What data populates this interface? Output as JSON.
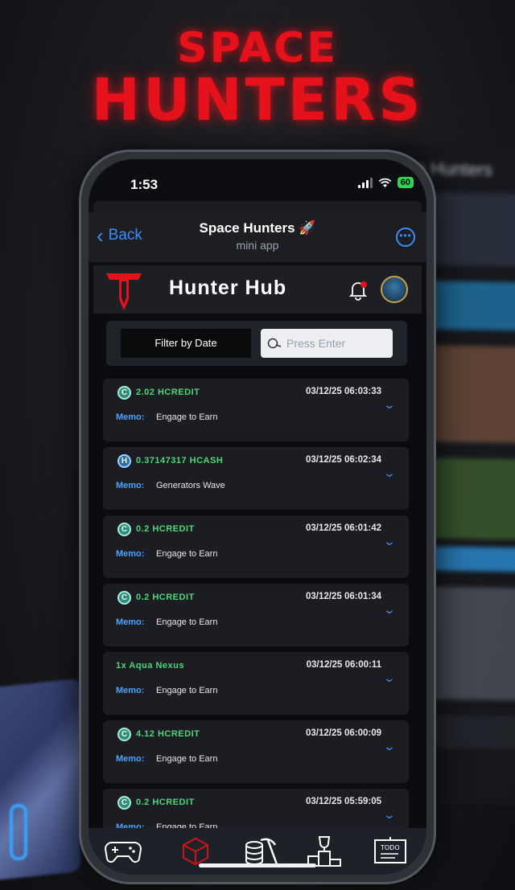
{
  "logo": {
    "line1": "SPACE",
    "line2": "HUNTERS"
  },
  "background_phone": {
    "title": "e Hunters"
  },
  "status_bar": {
    "time": "1:53",
    "battery": "60"
  },
  "nav": {
    "back_label": "Back",
    "title": "Space Hunters 🚀",
    "subtitle": "mini app"
  },
  "header": {
    "title": "Hunter Hub"
  },
  "filter": {
    "date_button": "Filter by Date",
    "search_placeholder": "Press Enter"
  },
  "memo_label": "Memo:",
  "transactions": [
    {
      "icon": "hcredit-coin-icon",
      "icon_glyph": "C",
      "amount": "2.02 HCREDIT",
      "date": "03/12/25 06:03:33",
      "memo": "Engage to Earn"
    },
    {
      "icon": "hcash-coin-icon",
      "icon_glyph": "H",
      "amount": "0.37147317 HCASH",
      "date": "03/12/25 06:02:34",
      "memo": "Generators Wave"
    },
    {
      "icon": "hcredit-coin-icon",
      "icon_glyph": "C",
      "amount": "0.2 HCREDIT",
      "date": "03/12/25 06:01:42",
      "memo": "Engage to Earn"
    },
    {
      "icon": "hcredit-coin-icon",
      "icon_glyph": "C",
      "amount": "0.2 HCREDIT",
      "date": "03/12/25 06:01:34",
      "memo": "Engage to Earn"
    },
    {
      "icon": "",
      "icon_glyph": "",
      "amount": "1x Aqua Nexus",
      "date": "03/12/25 06:00:11",
      "memo": "Engage to Earn"
    },
    {
      "icon": "hcredit-coin-icon",
      "icon_glyph": "C",
      "amount": "4.12 HCREDIT",
      "date": "03/12/25 06:00:09",
      "memo": "Engage to Earn"
    },
    {
      "icon": "hcredit-coin-icon",
      "icon_glyph": "C",
      "amount": "0.2 HCREDIT",
      "date": "03/12/25 05:59:05",
      "memo": "Engage to Earn"
    }
  ],
  "tabs": [
    {
      "icon": "gamepad-icon",
      "active": false
    },
    {
      "icon": "cube-icon",
      "active": true
    },
    {
      "icon": "mining-icon",
      "active": false
    },
    {
      "icon": "trophy-podium-icon",
      "active": false
    },
    {
      "icon": "todo-board-icon",
      "active": false
    }
  ],
  "colors": {
    "logo_red": "#e5121b",
    "ios_blue": "#3d8ff7",
    "amount_green": "#4fd67a",
    "memo_blue": "#4aa3ff",
    "active_tab_red": "#c0161d"
  }
}
